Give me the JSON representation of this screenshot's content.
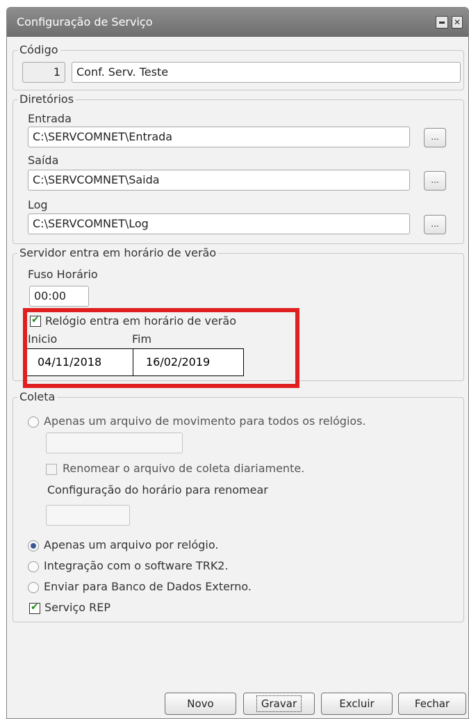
{
  "window": {
    "title": "Configuração de Serviço"
  },
  "codigo": {
    "legend": "Código",
    "number": "1",
    "name": "Conf. Serv. Teste"
  },
  "diretorios": {
    "legend": "Diretórios",
    "entrada_label": "Entrada",
    "entrada_value": "C:\\SERVCOMNET\\Entrada",
    "saida_label": "Saída",
    "saida_value": "C:\\SERVCOMNET\\Saida",
    "log_label": "Log",
    "log_value": "C:\\SERVCOMNET\\Log",
    "browse_label": "..."
  },
  "horario": {
    "legend": "Servidor entra em horário de verão",
    "fuso_label": "Fuso Horário",
    "fuso_value": "00:00",
    "relogio_label": "Relógio entra em horário de verão",
    "relogio_checked": true,
    "inicio_label": "Inicio",
    "fim_label": "Fim",
    "inicio_value": "04/11/2018",
    "fim_value": "16/02/2019"
  },
  "coleta": {
    "legend": "Coleta",
    "opt_um_arquivo_todos": "Apenas um arquivo de movimento para todos os relógios.",
    "arquivo_value": "",
    "renomear_label": "Renomear o arquivo de coleta diariamente.",
    "config_horario_label": "Configuração do horário para renomear",
    "horario_value": "",
    "opt_um_por_relogio": "Apenas um arquivo por relógio.",
    "opt_trk2": "Integração com o software TRK2.",
    "opt_banco": "Enviar para Banco de Dados Externo.",
    "servico_rep_label": "Serviço REP",
    "selected_option": "Apenas um arquivo por relógio.",
    "servico_rep_checked": true
  },
  "buttons": {
    "novo": "Novo",
    "gravar": "Gravar",
    "excluir": "Excluir",
    "fechar": "Fechar"
  },
  "colors": {
    "highlight": "#e02020",
    "check": "#1f8a1f",
    "titlebar": "#7d7d7d"
  }
}
